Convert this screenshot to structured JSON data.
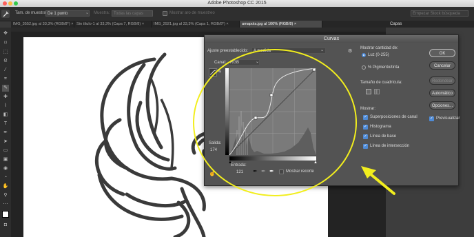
{
  "app": {
    "window_title": "Adobe Photoshop CC 2015",
    "search_placeholder": "Empezar Stock búsqueda"
  },
  "options_bar": {
    "sample_size_label": "Tam. de muestra:",
    "sample_size_value": "De 1 punto",
    "sample_label": "Muestra:",
    "sample_value": "Todas las capas",
    "show_ring_label": "Mostrar aro de muestreo"
  },
  "tabs": [
    {
      "label": "IMG_3552.jpg al 33,3% (RGB/8*) ×"
    },
    {
      "label": "Sin título-1 al 33,3% (Capa 7, RGB/8) ×"
    },
    {
      "label": "IMG_2921.jpg al 33,3% (Capa 1, RGB/8*) ×"
    },
    {
      "label": "amapola.jpg al 100% (RGB/8) ×"
    }
  ],
  "panel": {
    "header": "Capas"
  },
  "curves": {
    "title": "Curvas",
    "preset_label": "Ajuste preestablecido:",
    "preset_value": "A medida",
    "channel_label": "Canal:",
    "channel_value": "RGB",
    "output_label": "Salida:",
    "output_value": "174",
    "input_label": "Entrada:",
    "input_value": "121",
    "show_clipping_label": "Mostrar recorte",
    "show_amount_title": "Mostrar cantidad de:",
    "radio_light": "Luz (0-255)",
    "radio_pigment": "% Pigmento/tinta",
    "grid_size_title": "Tamaño de cuadrícula:",
    "show_title": "Mostrar:",
    "chk_channel_overlays": "Superposiciones de canal",
    "chk_histogram": "Histograma",
    "chk_baseline": "Línea de base",
    "chk_intersection": "Línea de intersección",
    "btn_ok": "OK",
    "btn_cancel": "Cancelar",
    "btn_smooth": "Redondear",
    "btn_auto": "Automático",
    "btn_options": "Opciones...",
    "chk_preview": "Previsualizar"
  },
  "colors": {
    "highlight_circle": "#f2ee1e",
    "arrow": "#f2ee1e",
    "accent": "#4f8bd6"
  }
}
